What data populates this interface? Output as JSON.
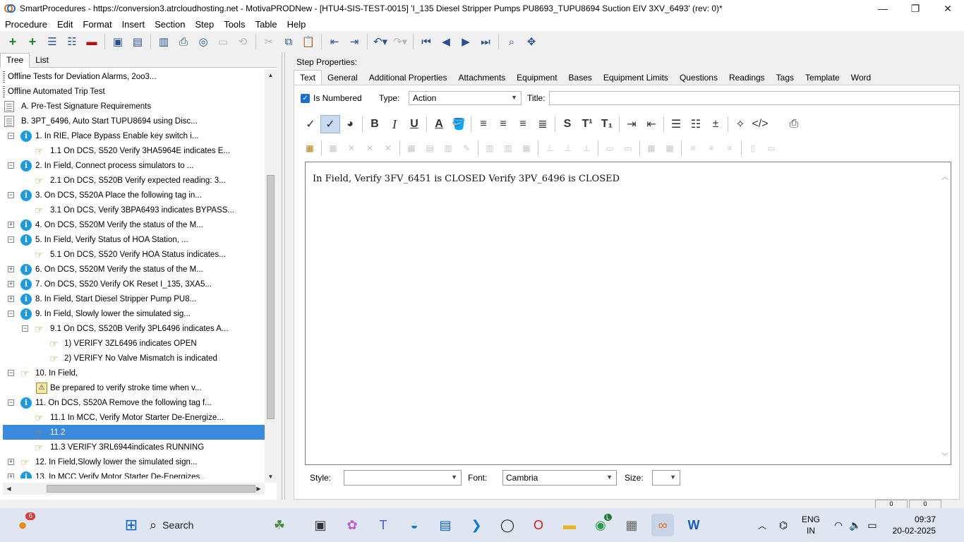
{
  "window": {
    "title": "SmartProcedures - https://conversion3.atrcloudhosting.net - MotivaPRODNew - [HTU4-SIS-TEST-0015] 'I_135 Diesel Stripper Pumps PU8693_TUPU8694 Suction EIV 3XV_6493' (rev: 0)*",
    "minimize": "—",
    "maximize": "❐",
    "close": "✕"
  },
  "menu": [
    "Procedure",
    "Edit",
    "Format",
    "Insert",
    "Section",
    "Step",
    "Tools",
    "Table",
    "Help"
  ],
  "left_tabs": [
    "Tree",
    "List"
  ],
  "tree": [
    {
      "label": "Offline Tests for Deviation Alarms, 2oo3...",
      "icon": "ruler-icon"
    },
    {
      "label": "Offline Automated Trip Test",
      "icon": "ruler-icon"
    },
    {
      "label": "A. Pre-Test Signature Requirements",
      "icon": "document-icon"
    },
    {
      "label": "B. 3PT_6496, Auto Start TUPU8694 using Disc...",
      "icon": "document-icon"
    },
    {
      "label": "1. In RIE, Place Bypass Enable key switch i...",
      "icon": "info-icon",
      "expander": "−"
    },
    {
      "label": "1.1 On DCS, S520 Verify 3HA5964E indicates E...",
      "icon": "hand-icon"
    },
    {
      "label": "2. In Field, Connect process simulators to ...",
      "icon": "info-icon",
      "expander": "−"
    },
    {
      "label": "2.1 On DCS, S520B Verify expected reading: 3...",
      "icon": "hand-icon"
    },
    {
      "label": "3. On DCS, S520A Place the following tag in...",
      "icon": "info-icon",
      "expander": "−"
    },
    {
      "label": "3.1 On DCS, Verify 3BPA6493 indicates BYPASS...",
      "icon": "hand-icon"
    },
    {
      "label": "4. On DCS, S520M Verify the status of the M...",
      "icon": "info-icon",
      "expander": "+"
    },
    {
      "label": "5. In Field, Verify Status of HOA Station, ...",
      "icon": "info-icon",
      "expander": "−"
    },
    {
      "label": "5.1 On DCS, S520 Verify HOA Status indicates...",
      "icon": "hand-icon"
    },
    {
      "label": "6. On DCS, S520M Verify the status of the M...",
      "icon": "info-icon",
      "expander": "+"
    },
    {
      "label": "7. On DCS, S520 Verify OK Reset I_135, 3XA5...",
      "icon": "info-icon",
      "expander": "+"
    },
    {
      "label": "8. In Field, Start Diesel Stripper Pump PU8...",
      "icon": "info-icon",
      "expander": "+"
    },
    {
      "label": "9. In Field, Slowly lower the simulated sig...",
      "icon": "info-icon",
      "expander": "−"
    },
    {
      "label": "9.1 On DCS, S520B Verify 3PL6496 indicates A...",
      "icon": "hand-icon",
      "expander": "−"
    },
    {
      "label": "1) VERIFY 3ZL6496 indicates OPEN",
      "icon": "hand-icon"
    },
    {
      "label": "2) VERIFY No Valve Mismatch is indicated",
      "icon": "hand-icon"
    },
    {
      "label": "10. In Field,",
      "icon": "hand-icon",
      "expander": "−"
    },
    {
      "label": "Be prepared to verify stroke time when v...",
      "icon": "warning-icon"
    },
    {
      "label": "11. On DCS, S520A Remove the following tag f...",
      "icon": "info-icon",
      "expander": "−"
    },
    {
      "label": "11.1 In MCC, Verify Motor Starter De-Energize...",
      "icon": "hand-icon"
    },
    {
      "label": "11.2",
      "icon": "hand-icon",
      "selected": true
    },
    {
      "label": "11.3 VERIFY 3RL6944indicates RUNNING",
      "icon": "hand-icon"
    },
    {
      "label": "12. In Field,Slowly lower the simulated sign...",
      "icon": "hand-icon",
      "expander": "+"
    },
    {
      "label": "13. In MCC,Verify Motor Starter De-Energizes...",
      "icon": "info-icon",
      "expander": "+"
    }
  ],
  "step_properties": {
    "heading": "Step Properties:",
    "tabs": [
      "Text",
      "General",
      "Additional Properties",
      "Attachments",
      "Equipment",
      "Bases",
      "Equipment Limits",
      "Questions",
      "Readings",
      "Tags",
      "Template",
      "Word"
    ],
    "is_numbered_label": "Is Numbered",
    "is_numbered_checked": true,
    "type_label": "Type:",
    "type_value": "Action",
    "title_label": "Title:",
    "title_value": "",
    "editor_text": "In Field, Verify 3FV_6451 is CLOSED Verify 3PV_6496 is CLOSED",
    "style_label": "Style:",
    "style_value": "",
    "font_label": "Font:",
    "font_value": "Cambria",
    "size_label": "Size:",
    "size_value": ""
  },
  "format_toolbar": {
    "bold": "B",
    "italic": "I",
    "underline": "U",
    "font_color": "A",
    "strike": "S",
    "superscript": "T¹",
    "subscript": "T₁",
    "code": "</>"
  },
  "status_bar": {
    "cell1": "0",
    "cell2": "0"
  },
  "taskbar": {
    "search_placeholder": "Search",
    "notification_count": "6",
    "lang_line1": "ENG",
    "lang_line2": "IN",
    "time": "09:37",
    "date": "20-02-2025",
    "chrome_badge": "L"
  },
  "colors": {
    "accent": "#3c8ade",
    "info_icon": "#1e9be0",
    "checkbox": "#1c6fd0"
  }
}
